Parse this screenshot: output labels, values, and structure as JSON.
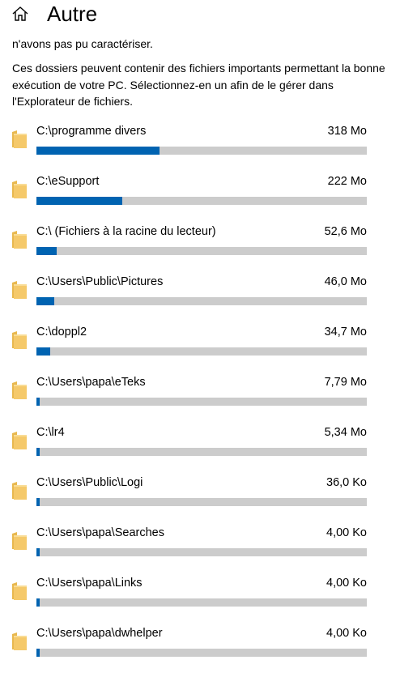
{
  "header": {
    "title": "Autre",
    "home_icon": "home-icon"
  },
  "intro": {
    "cut_line": "n'avons pas pu caractériser.",
    "description": "Ces dossiers peuvent contenir des fichiers importants permettant la bonne exécution de votre PC. Sélectionnez-en un afin de le gérer dans l'Explorateur de fichiers."
  },
  "colors": {
    "accent": "#0063b1",
    "track": "#cccccc",
    "folder": "#f5c96a"
  },
  "folders": [
    {
      "path": "C:\\programme divers",
      "size": "318 Mo",
      "usage": 0.373
    },
    {
      "path": "C:\\eSupport",
      "size": "222 Mo",
      "usage": 0.26
    },
    {
      "path": "C:\\ (Fichiers à la racine du lecteur)",
      "size": "52,6 Mo",
      "usage": 0.061
    },
    {
      "path": "C:\\Users\\Public\\Pictures",
      "size": "46,0 Mo",
      "usage": 0.054
    },
    {
      "path": "C:\\doppl2",
      "size": "34,7 Mo",
      "usage": 0.041
    },
    {
      "path": "C:\\Users\\papa\\eTeks",
      "size": "7,79 Mo",
      "usage": 0.009
    },
    {
      "path": "C:\\lr4",
      "size": "5,34 Mo",
      "usage": 0.006
    },
    {
      "path": "C:\\Users\\Public\\Logi",
      "size": "36,0 Ko",
      "usage": 0.001
    },
    {
      "path": "C:\\Users\\papa\\Searches",
      "size": "4,00 Ko",
      "usage": 0.001
    },
    {
      "path": "C:\\Users\\papa\\Links",
      "size": "4,00 Ko",
      "usage": 0.001
    },
    {
      "path": "C:\\Users\\papa\\dwhelper",
      "size": "4,00 Ko",
      "usage": 0.001
    }
  ]
}
